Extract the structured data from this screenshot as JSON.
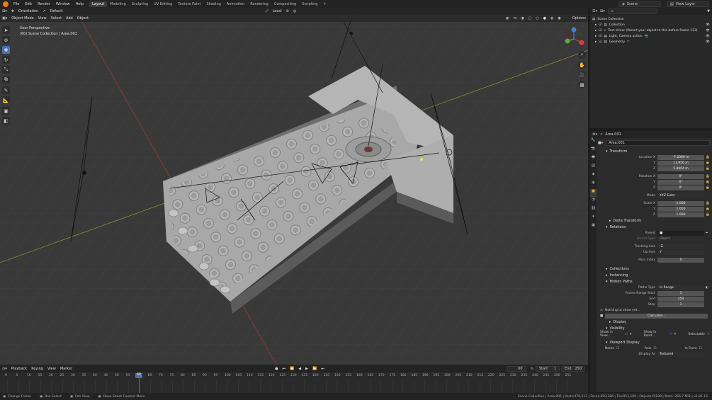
{
  "menu": [
    "File",
    "Edit",
    "Render",
    "Window",
    "Help"
  ],
  "workspaces": [
    "Layout",
    "Modeling",
    "Sculpting",
    "UV Editing",
    "Texture Paint",
    "Shading",
    "Animation",
    "Rendering",
    "Compositing",
    "Scripting"
  ],
  "active_workspace": "Layout",
  "transform_orientation": {
    "label": "Orientation",
    "value": "Default"
  },
  "pivot": "Local",
  "scene": "Scene",
  "view_layer": "View Layer",
  "viewport_header": {
    "mode": "Object Mode",
    "menus": [
      "View",
      "Select",
      "Add",
      "Object"
    ],
    "options": "Options"
  },
  "viewport_overlay": {
    "line1": "User Perspective",
    "line2": "(60) Scene Collection | Area.001"
  },
  "gizmo": {
    "x": "X",
    "y": "Y",
    "z": "Z"
  },
  "outliner": {
    "rows": [
      {
        "label": "Scene Collection"
      },
      {
        "label": "Collection"
      },
      {
        "label": "Text driver (Parent your object to this before frame 123)"
      },
      {
        "label": "Light, Camera action"
      },
      {
        "label": "Geometry"
      }
    ]
  },
  "props": {
    "object_name": "Area.001",
    "object_field": "Area.001",
    "transform_title": "Transform",
    "location_x": {
      "label": "Location X",
      "value": "-7.2009 m"
    },
    "location_y": {
      "label": "Y",
      "value": "13.956 m"
    },
    "location_z": {
      "label": "Z",
      "value": "5.8904 m"
    },
    "rotation_x": {
      "label": "Rotation X",
      "value": "0°"
    },
    "rotation_y": {
      "label": "Y",
      "value": "0°"
    },
    "rotation_z": {
      "label": "Z",
      "value": "0°"
    },
    "mode": {
      "label": "Mode",
      "value": "XYZ Euler"
    },
    "scale_x": {
      "label": "Scale X",
      "value": "1.000"
    },
    "scale_y": {
      "label": "Y",
      "value": "1.000"
    },
    "scale_z": {
      "label": "Z",
      "value": "1.000"
    },
    "delta": "Delta Transform",
    "relations": "Relations",
    "parent": {
      "label": "Parent",
      "value": ""
    },
    "parent_type": {
      "label": "Parent Type",
      "value": "Object"
    },
    "tracking": {
      "label": "Tracking Axis",
      "value": "-Z"
    },
    "up_axis": {
      "label": "Up Axis",
      "value": "Y"
    },
    "pass_index": {
      "label": "Pass Index",
      "value": "0"
    },
    "collections": "Collections",
    "instancing": "Instancing",
    "motion_paths": "Motion Paths",
    "paths_type": {
      "label": "Paths Type",
      "value": "In Range"
    },
    "frame_start": {
      "label": "Frame Range Start",
      "value": "1"
    },
    "frame_end": {
      "label": "End",
      "value": "250"
    },
    "frame_step": {
      "label": "Step",
      "value": "1"
    },
    "nothing": "Nothing to show yet...",
    "calc_button": "Calculate...",
    "display_sub": "Display",
    "visibility": "Visibility",
    "show_in_view": "Show in View...",
    "show_in_render": "Show in Rend...",
    "selectable": "Selectable",
    "viewport_display": "Viewport Display",
    "name_label": "Name",
    "axis_label": "Axis",
    "in_front": "In Front",
    "display_as": {
      "label": "Display As",
      "value": "Textured"
    }
  },
  "timeline": {
    "menus": [
      "Playback",
      "Keying",
      "View",
      "Marker"
    ],
    "current_frame": "60",
    "start_label": "Start",
    "start": "1",
    "end_label": "End",
    "end": "250",
    "ticks": [
      "0",
      "5",
      "10",
      "15",
      "20",
      "25",
      "30",
      "35",
      "40",
      "45",
      "50",
      "55",
      "60",
      "65",
      "70",
      "75",
      "80",
      "85",
      "90",
      "95",
      "100",
      "105",
      "110",
      "115",
      "120",
      "125",
      "130",
      "135",
      "140",
      "145",
      "150",
      "155",
      "160",
      "165",
      "170",
      "175",
      "180",
      "185",
      "190",
      "195",
      "200",
      "205",
      "210",
      "215",
      "220",
      "225",
      "230",
      "235",
      "240",
      "245",
      "250",
      "255"
    ]
  },
  "status": {
    "change_frame": "Change Frame",
    "box_select": "Box Select",
    "pan_view": "Pan View",
    "dope_menu": "Dope Sheet Context Menu",
    "stats": "Scene Collection | Area.001 | Verts:476,212 | Faces:450,186 | Tris:851,108 | Objects:0/188 | Mem: 266.7 MiB | v2.81.16"
  },
  "colors": {
    "accent": "#4772b3",
    "header": "#232323",
    "viewport": "#393939",
    "orange": "#e87d0d"
  }
}
